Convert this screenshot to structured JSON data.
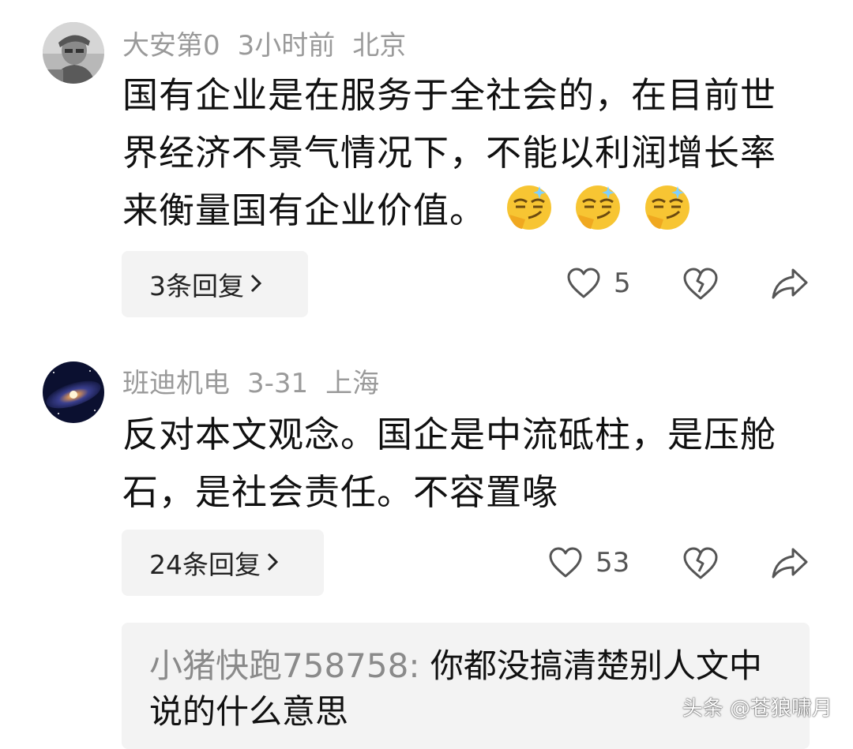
{
  "comments": [
    {
      "username": "大安第0",
      "time": "3小时前",
      "location": "北京",
      "text": "国有企业是在服务于全社会的，在目前世界经济不景气情况下，不能以利润增长率来衡量国有企业价值。",
      "emoji": [
        "smirk-emoji",
        "smirk-emoji",
        "smirk-emoji"
      ],
      "replies_label": "3条回复",
      "like_count": "5"
    },
    {
      "username": "班迪机电",
      "time": "3-31",
      "location": "上海",
      "text": "反对本文观念。国企是中流砥柱，是压舱石，是社会责任。不容置喙",
      "replies_label": "24条回复",
      "like_count": "53",
      "quoted_reply": {
        "author": "小猪快跑758758:",
        "text": " 你都没搞清楚别人文中说的什么意思"
      }
    }
  ],
  "watermark": "头条 @苍狼啸月",
  "icons": {
    "like": "heart-outline-icon",
    "dislike": "broken-heart-icon",
    "share": "share-arrow-icon",
    "chevron": "chevron-right-icon"
  },
  "colors": {
    "meta_text": "#9a9a9a",
    "reply_bg": "#f3f3f3",
    "body_text": "#111111"
  }
}
